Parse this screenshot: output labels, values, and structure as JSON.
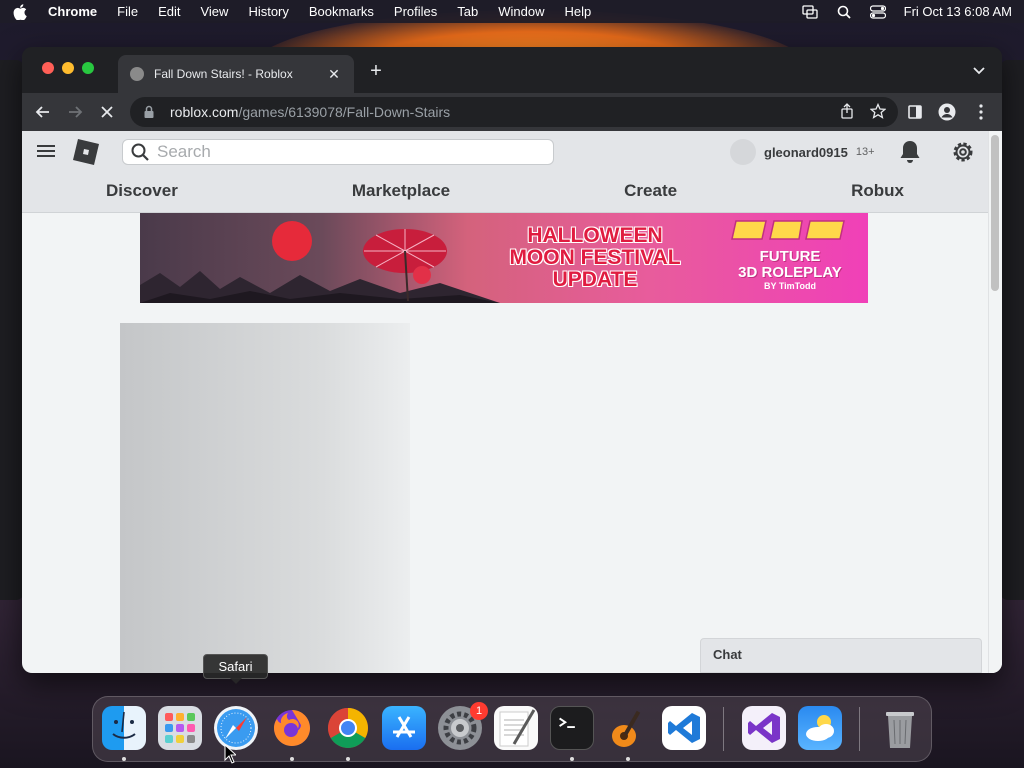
{
  "menubar": {
    "app_name": "Chrome",
    "items": [
      "File",
      "Edit",
      "View",
      "History",
      "Bookmarks",
      "Profiles",
      "Tab",
      "Window",
      "Help"
    ],
    "clock": "Fri Oct 13  6:08 AM"
  },
  "browser": {
    "tab_title": "Fall Down Stairs! - Roblox",
    "url_host": "roblox.com",
    "url_path": "/games/6139078/Fall-Down-Stairs"
  },
  "roblox": {
    "search_placeholder": "Search",
    "username": "gleonard0915",
    "age_label": "13+",
    "nav": [
      "Discover",
      "Marketplace",
      "Create",
      "Robux"
    ],
    "banner": {
      "headline_1": "HALLOWEEN",
      "headline_2": "MOON FESTIVAL",
      "headline_3": "UPDATE",
      "logo_1": "FUTURE",
      "logo_2": "3D ROLEPLAY",
      "logo_by": "BY TimTodd"
    },
    "chat_label": "Chat"
  },
  "dock": {
    "tooltip": "Safari",
    "apps": [
      "finder",
      "launchpad",
      "safari",
      "firefox",
      "chrome",
      "app-store",
      "system-settings",
      "textedit",
      "terminal",
      "garageband",
      "vscode",
      "visual-studio",
      "weather",
      "trash"
    ],
    "settings_badge": "1"
  },
  "colors": {
    "roblox_header": "#e3e5e8",
    "chrome_dark": "#202124",
    "banner_pink": "#e85c9c"
  }
}
